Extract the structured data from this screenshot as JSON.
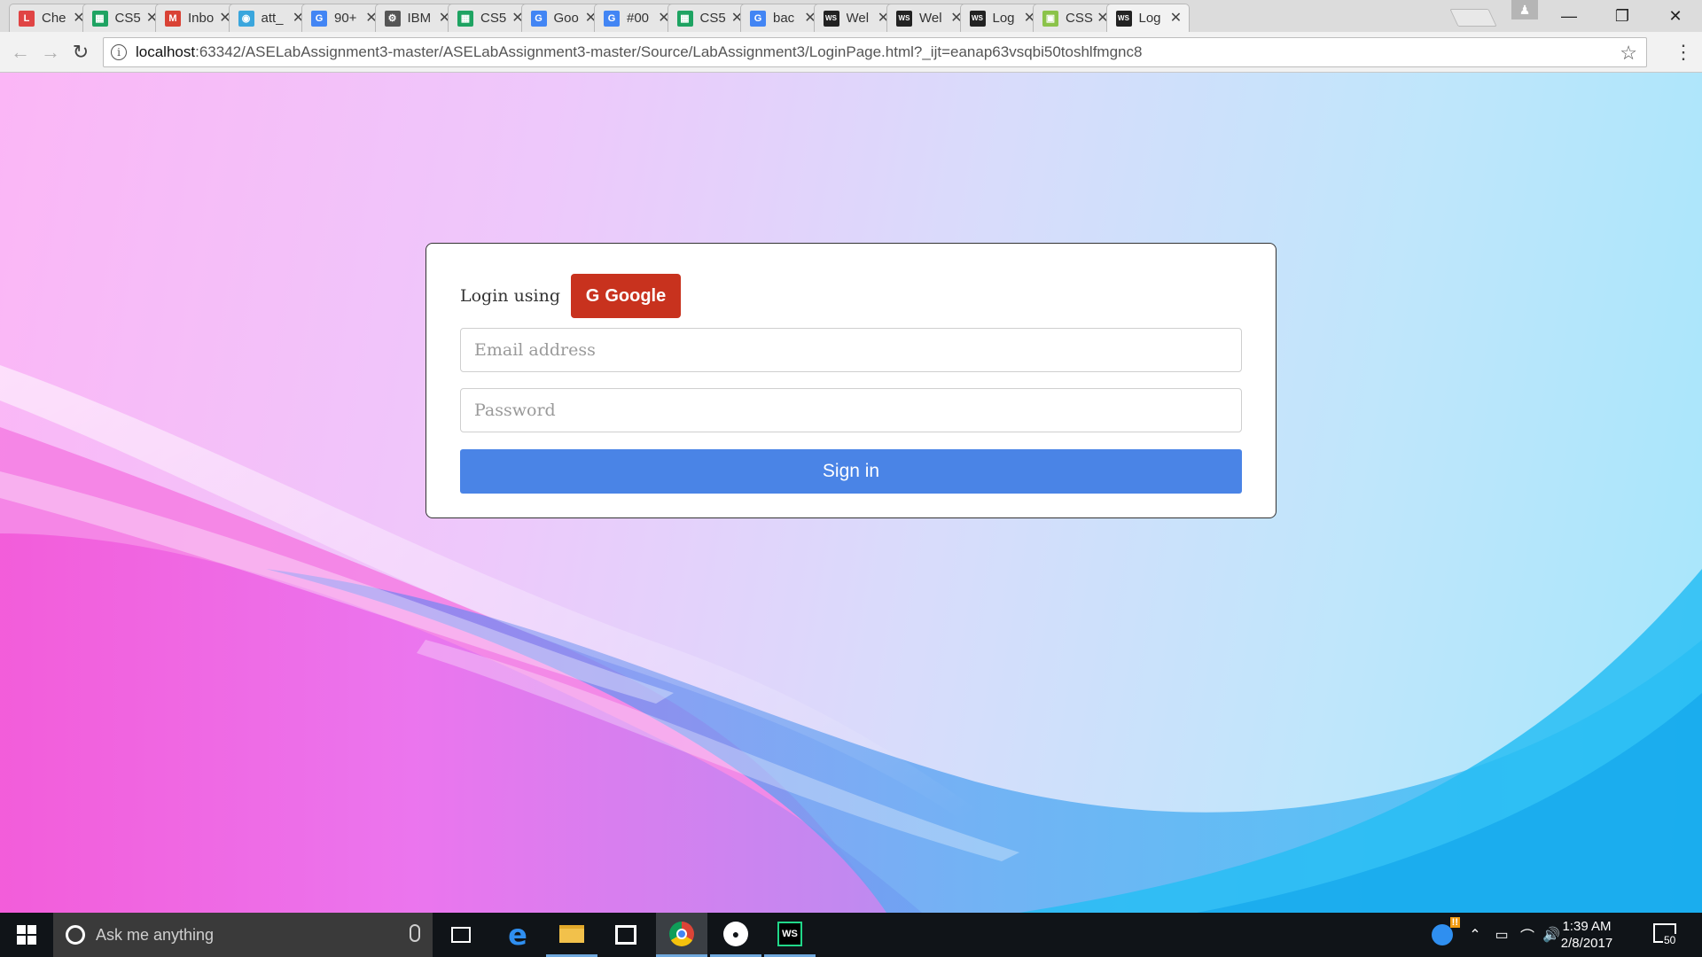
{
  "browser": {
    "tabs": [
      {
        "title": "Che",
        "favicon": "L",
        "color": "#e04444"
      },
      {
        "title": "CS5",
        "favicon": "▦",
        "color": "#1ea362"
      },
      {
        "title": "Inbo",
        "favicon": "M",
        "color": "#d94235"
      },
      {
        "title": "att_",
        "favicon": "◉",
        "color": "#3aa6dd"
      },
      {
        "title": "90+",
        "favicon": "G",
        "color": "#4285f4"
      },
      {
        "title": "IBM",
        "favicon": "⚙",
        "color": "#555555"
      },
      {
        "title": "CS5",
        "favicon": "▦",
        "color": "#1ea362"
      },
      {
        "title": "Goo",
        "favicon": "G",
        "color": "#4285f4"
      },
      {
        "title": "#00",
        "favicon": "G",
        "color": "#4285f4"
      },
      {
        "title": "CS5",
        "favicon": "▦",
        "color": "#1ea362"
      },
      {
        "title": "bac",
        "favicon": "G",
        "color": "#4285f4"
      },
      {
        "title": "Wel",
        "favicon": "WS",
        "color": "#222222"
      },
      {
        "title": "Wel",
        "favicon": "WS",
        "color": "#222222"
      },
      {
        "title": "Log",
        "favicon": "WS",
        "color": "#222222"
      },
      {
        "title": "CSS",
        "favicon": "▣",
        "color": "#8bc34a"
      },
      {
        "title": "Log",
        "favicon": "WS",
        "color": "#222222",
        "active": true
      }
    ],
    "url_host": "localhost",
    "url_rest": ":63342/ASELabAssignment3-master/ASELabAssignment3-master/Source/LabAssignment3/LoginPage.html?_ijt=eanap63vsqbi50toshlfmgnc8",
    "icons": {
      "back": "←",
      "forward": "→",
      "reload": "↻",
      "star": "☆",
      "menu": "⋮",
      "info": "i",
      "close_tab": "✕",
      "minimize": "—",
      "restore": "❐",
      "close_window": "✕"
    }
  },
  "login": {
    "login_using": "Login using",
    "google_label": "Google",
    "google_icon": "G",
    "email_placeholder": "Email address",
    "password_placeholder": "Password",
    "signin_label": "Sign in",
    "google_color": "#c8321e",
    "signin_color": "#4a84e6"
  },
  "taskbar": {
    "search_placeholder": "Ask me anything",
    "time": "1:39 AM",
    "date": "2/8/2017",
    "notification_count": "50"
  }
}
